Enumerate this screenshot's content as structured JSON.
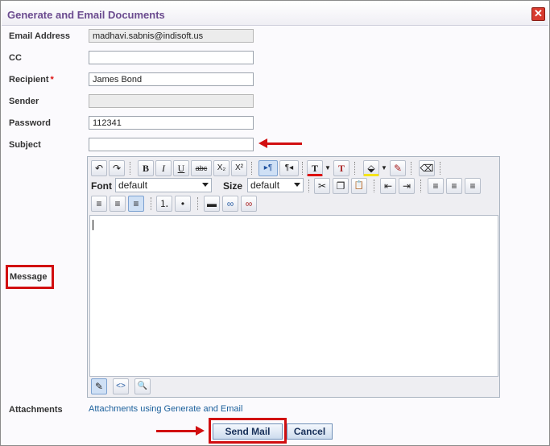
{
  "dialog": {
    "title": "Generate and Email Documents",
    "close_symbol": "✕"
  },
  "form": {
    "email_address": {
      "label": "Email Address",
      "value": "madhavi.sabnis@indisoft.us"
    },
    "cc": {
      "label": "CC",
      "value": ""
    },
    "recipient": {
      "label": "Recipient",
      "required_mark": "*",
      "value": "James Bond"
    },
    "sender": {
      "label": "Sender",
      "value": ""
    },
    "password": {
      "label": "Password",
      "value": "112341"
    },
    "subject": {
      "label": "Subject",
      "value": ""
    },
    "message": {
      "label": "Message"
    },
    "attachments": {
      "label": "Attachments",
      "link_text": "Attachments using Generate and Email"
    }
  },
  "editor": {
    "font_label": "Font",
    "font_value": "default",
    "size_label": "Size",
    "size_value": "default",
    "toolbar_glyphs": {
      "undo": "↶",
      "redo": "↷",
      "bold": "B",
      "italic": "I",
      "underline": "U",
      "strike": "abc",
      "subscript": "X₂",
      "superscript": "X²",
      "ltr": "▸¶",
      "rtl": "¶◂",
      "text_color": "T",
      "remove_format": "T",
      "highlight": "⬙",
      "remove_highlight": "✎",
      "eraser": "⌫",
      "cut": "✂",
      "copy": "❐",
      "paste": "📋",
      "outdent": "⇤",
      "indent": "⇥",
      "align_left": "≡",
      "align_center": "≡",
      "align_right": "≡",
      "justify": "≡",
      "ordered_list": "⒈",
      "unordered_list": "•",
      "hr": "▬",
      "link": "∞",
      "unlink": "∞",
      "design_mode": "✎",
      "html_mode": "<>",
      "preview_mode": "🔍"
    }
  },
  "buttons": {
    "send": "Send Mail",
    "cancel": "Cancel"
  },
  "colors": {
    "title": "#6b4b8f",
    "highlight_red": "#d10e10",
    "link": "#1a5f9b"
  }
}
